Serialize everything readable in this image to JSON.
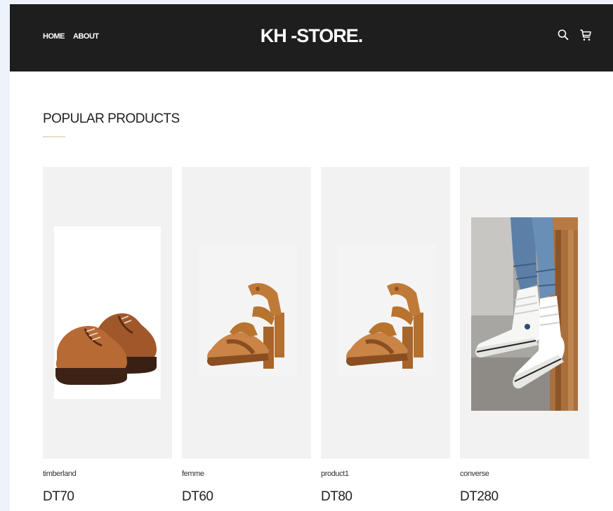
{
  "brand": "KH -STORE.",
  "nav": {
    "links": [
      "HOME",
      "ABOUT"
    ],
    "icons": [
      "search-icon",
      "cart-icon"
    ]
  },
  "section": {
    "title": "POPULAR PRODUCTS"
  },
  "products": [
    {
      "name": "timberland",
      "price": "DT70"
    },
    {
      "name": "femme",
      "price": "DT60"
    },
    {
      "name": "product1",
      "price": "DT80"
    },
    {
      "name": "converse",
      "price": "DT280"
    }
  ],
  "colors": {
    "navbar": "#1e1e1e",
    "card_background": "#f2f2f2",
    "accent_underline": "#e9dcc8",
    "text": "#222222"
  }
}
